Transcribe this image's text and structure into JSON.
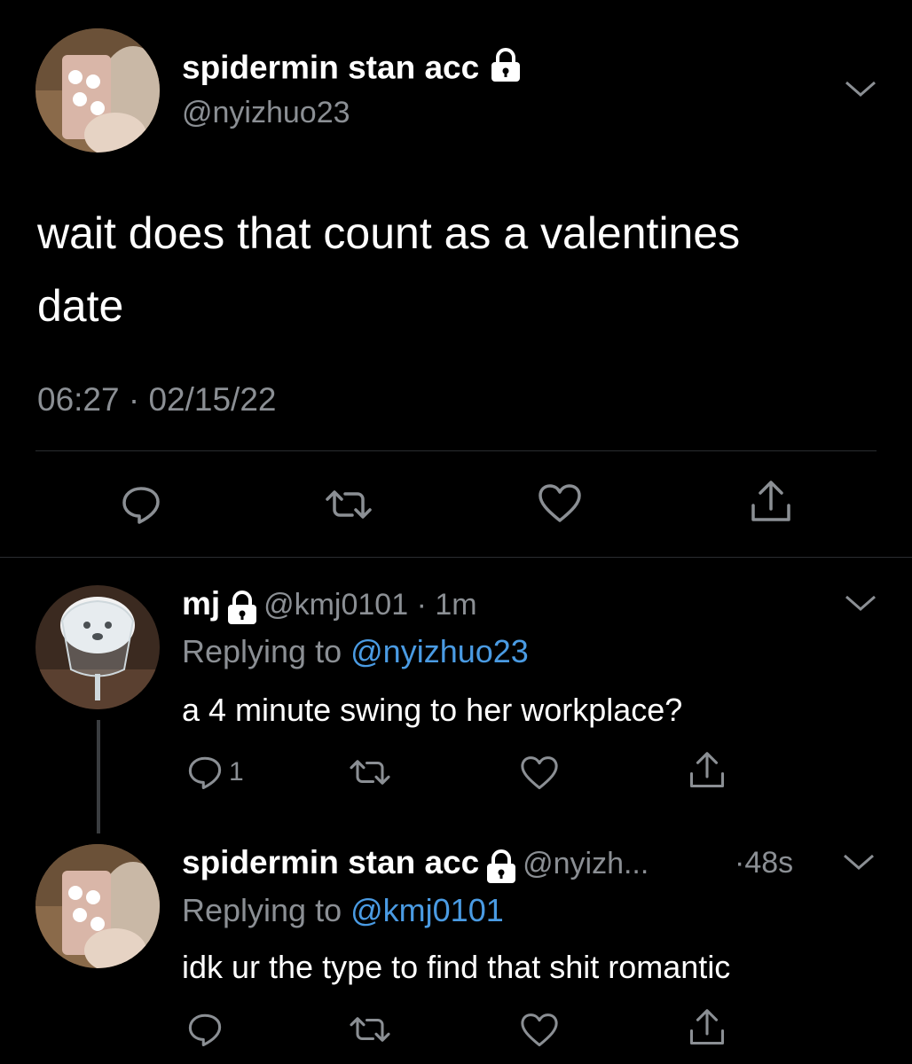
{
  "main_tweet": {
    "display_name": "spidermin stan acc",
    "handle": "@nyizhuo23",
    "text_line1": "wait does that count as a valentines",
    "text_line2": "date",
    "timestamp": "06:27 · 02/15/22"
  },
  "reply1": {
    "display_name": "mj",
    "handle_time": "@kmj0101 · 1m",
    "replying_prefix": "Replying to",
    "replying_to": "@nyizhuo23",
    "text": "a 4 minute swing to her workplace?",
    "reply_count": "1"
  },
  "reply2": {
    "display_name": "spidermin stan acc",
    "handle": "@nyizh...",
    "time": "·48s",
    "replying_prefix": "Replying to",
    "replying_to": "@kmj0101",
    "text": "idk ur the type to find that shit romantic"
  },
  "colors": {
    "background": "#000000",
    "muted": "#8b8f94",
    "link": "#4a9be3"
  },
  "icons": [
    "chevron-down-icon",
    "lock-icon",
    "reply-icon",
    "retweet-icon",
    "like-icon",
    "share-icon"
  ]
}
